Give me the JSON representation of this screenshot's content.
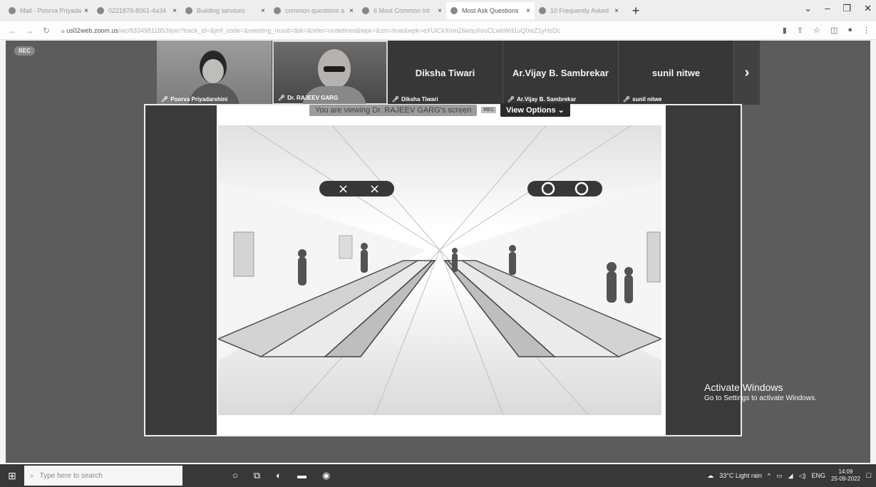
{
  "browser": {
    "tabs": [
      {
        "label": "Mail - Poorva Priyada",
        "icon": "mail-icon",
        "active": false
      },
      {
        "label": "0221879-8061-4a34",
        "icon": "globe-icon",
        "active": false
      },
      {
        "label": "Building services",
        "icon": "doc-icon",
        "active": false
      },
      {
        "label": "common questions a",
        "icon": "google-icon",
        "active": false
      },
      {
        "label": "6 Most Common Int",
        "icon": "site-icon",
        "active": false
      },
      {
        "label": "Most Ask Questions",
        "icon": "site-icon",
        "active": true
      },
      {
        "label": "10 Frequently Asked",
        "icon": "site-icon",
        "active": false
      }
    ],
    "url_host": "us02web.zoom.us",
    "url_rest": "/wc/83349811853/join?track_id=&jmf_code=&meeting_result=&tk=&refer=undefined&wpk=&zm=true&wpk=eXUiCkXmnZ6eopXouCLwbWd1uQ0wZ1yHsDc"
  },
  "meeting": {
    "rec_label": "REC",
    "participants": [
      {
        "name": "Poorva Priyadarshini",
        "has_video": true
      },
      {
        "name": "Dr. RAJEEV GARG",
        "has_video": true
      },
      {
        "name": "Diksha Tiwari",
        "has_video": false
      },
      {
        "name": "Ar.Vijay B. Sambrekar",
        "has_video": false
      },
      {
        "name": "sunil nitwe",
        "has_video": false
      }
    ],
    "viewing_text": "You are viewing Dr. RAJEEV GARG's screen",
    "viewing_badge": "REC",
    "view_options": "View Options ⌄",
    "next_arrow": "›"
  },
  "watermark": {
    "line1": "Activate Windows",
    "line2": "Go to Settings to activate Windows."
  },
  "taskbar": {
    "search_placeholder": "Type here to search",
    "weather": "33°C Light rain",
    "lang": "ENG",
    "time": "14:09",
    "date": "25-09-2022"
  }
}
